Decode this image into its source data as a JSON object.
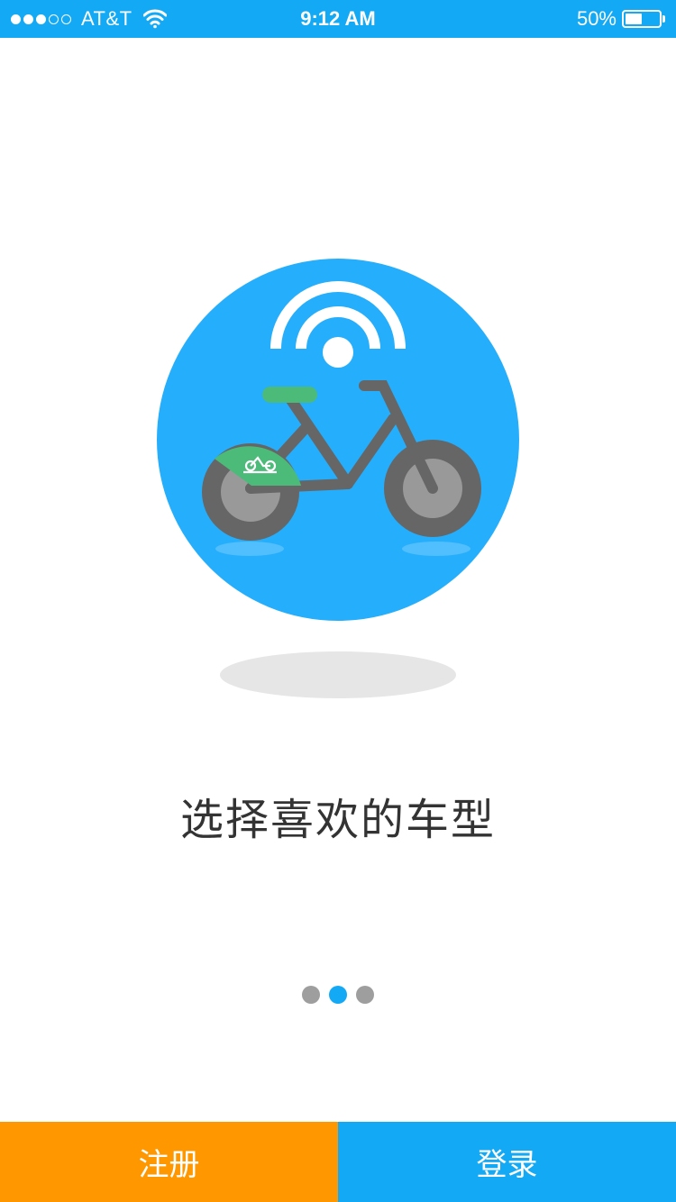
{
  "status_bar": {
    "carrier": "AT&T",
    "time": "9:12 AM",
    "battery_percent": "50%",
    "battery_level": 0.5,
    "signal_bars": 3,
    "signal_total": 5
  },
  "illustration": {
    "icon": "smart-bike-icon",
    "circle_color": "#25aefc",
    "basket_color": "#4cbb7a"
  },
  "title": "选择喜欢的车型",
  "pager": {
    "total": 3,
    "active_index": 1,
    "active_color": "#13a9f5",
    "inactive_color": "#9e9e9e"
  },
  "actions": {
    "register_label": "注册",
    "register_color": "#ff9800",
    "login_label": "登录",
    "login_color": "#13a9f5"
  }
}
